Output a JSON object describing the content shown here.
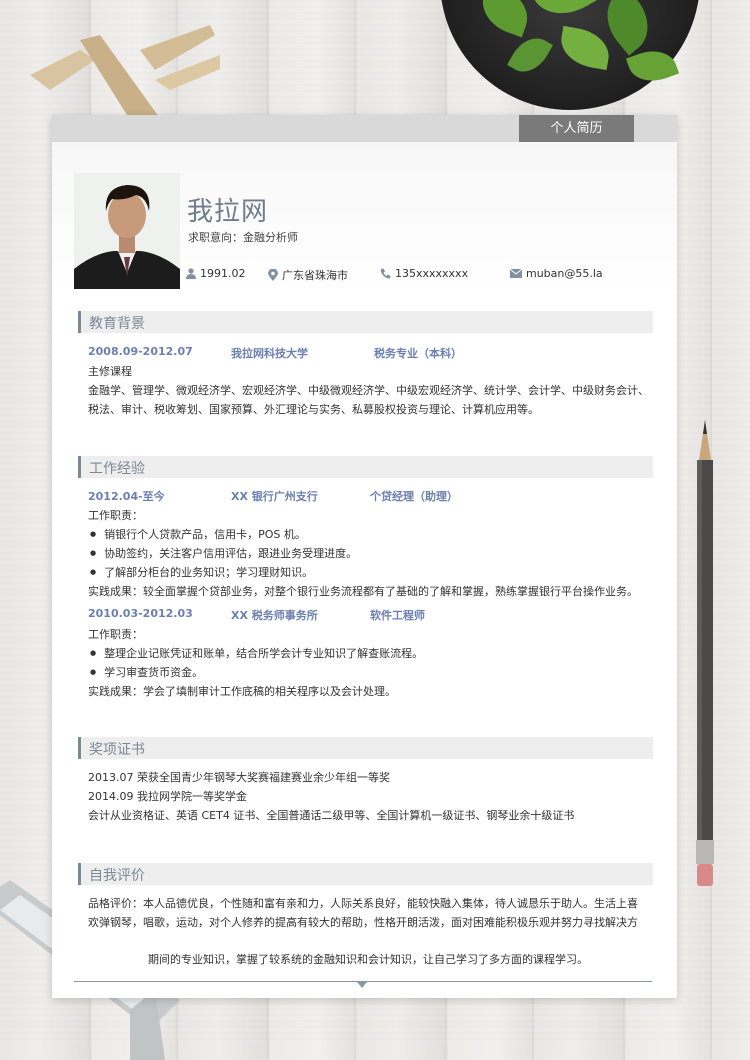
{
  "header": {
    "tag": "个人简历",
    "name": "我拉网",
    "intent_label": "求职意向：",
    "intent_value": "金融分析师",
    "birth": "1991.02",
    "location": "广东省珠海市",
    "phone": "135xxxxxxxx",
    "email": "muban@55.la"
  },
  "education": {
    "title": "教育背景",
    "period": "2008.09-2012.07",
    "school": "我拉网科技大学",
    "major": "税务专业（本科）",
    "courses_label": "主修课程",
    "courses_line1": "金融学、管理学、微观经济学、宏观经济学、中级微观经济学、中级宏观经济学、统计学、会计学、中级财务会计、",
    "courses_line2": "税法、审计、税收筹划、国家预算、外汇理论与实务、私募股权投资与理论、计算机应用等。"
  },
  "work": {
    "title": "工作经验",
    "jobs": [
      {
        "period": "2012.04-至今",
        "company": "XX 银行广州支行",
        "position": "个贷经理（助理）",
        "duty_label": "工作职责：",
        "duties": [
          "销银行个人贷款产品，信用卡，POS 机。",
          "协助签约，关注客户信用评估，跟进业务受理进度。",
          "了解部分柜台的业务知识；学习理财知识。"
        ],
        "result": "实践成果：较全面掌握个贷部业务，对整个银行业务流程都有了基础的了解和掌握，熟练掌握银行平台操作业务。"
      },
      {
        "period": "2010.03-2012.03",
        "company": "XX 税务师事务所",
        "position": "软件工程师",
        "duty_label": "工作职责：",
        "duties": [
          "整理企业记账凭证和账单，结合所学会计专业知识了解查账流程。",
          "学习审查货币资金。"
        ],
        "result": "实践成果：学会了填制审计工作底稿的相关程序以及会计处理。"
      }
    ]
  },
  "awards": {
    "title": "奖项证书",
    "items": [
      "2013.07  荣获全国青少年钢琴大奖赛福建赛业余少年组一等奖",
      "2014.09  我拉网学院一等奖学金",
      "会计从业资格证、英语 CET4 证书、全国普通话二级甲等、全国计算机一级证书、钢琴业余十级证书"
    ]
  },
  "self": {
    "title": "自我评价",
    "line1": "品格评价：本人品德优良，个性随和富有亲和力，人际关系良好，能较快融入集体，待人诚恳乐于助人。生活上喜",
    "line2": "欢弹钢琴，唱歌，运动，对个人修养的提高有较大的帮助，性格开朗活泼，面对困难能积极乐观并努力寻找解决方",
    "line3": "期间的专业知识，掌握了较系统的金融知识和会计知识，让自己学习了多方面的课程学习。"
  },
  "icons": {
    "birth": "person-icon",
    "location": "location-pin-icon",
    "phone": "phone-icon",
    "email": "envelope-icon"
  },
  "colors": {
    "accent": "#7b8896",
    "highlight": "#6b7fb0",
    "tag_bg": "#7a7a7a"
  }
}
